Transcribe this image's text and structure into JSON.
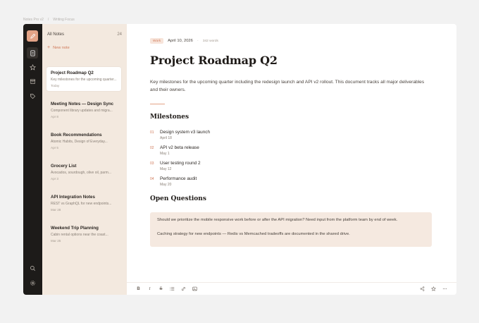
{
  "breadcrumb": [
    "Notes Pro v2",
    "Writing Focus"
  ],
  "rail": {
    "icons": [
      "pen-icon",
      "document-icon",
      "star-icon",
      "archive-icon",
      "tag-icon",
      "search-icon",
      "settings-icon"
    ]
  },
  "sidebar": {
    "title": "All Notes",
    "count": "24",
    "new_note": "New note",
    "notes": [
      {
        "title": "Project Roadmap Q2",
        "preview": "Key milestones for the upcoming quarter...",
        "date": "Today"
      },
      {
        "title": "Meeting Notes — Design Sync",
        "preview": "Component library updates and migra...",
        "date": "Apr 8"
      },
      {
        "title": "Book Recommendations",
        "preview": "Atomic Habits, Design of Everyday...",
        "date": "Apr 5"
      },
      {
        "title": "Grocery List",
        "preview": "Avocados, sourdough, olive oil, parm...",
        "date": "Apr 3"
      },
      {
        "title": "API Integration Notes",
        "preview": "REST vs GraphQL for new endpoints...",
        "date": "Mar 28"
      },
      {
        "title": "Weekend Trip Planning",
        "preview": "Cabin rental options near the coast...",
        "date": "Mar 25"
      }
    ]
  },
  "editor": {
    "tag": "Work",
    "date": "April 10, 2026",
    "words": "342 words",
    "title": "Project Roadmap Q2",
    "intro": "Key milestones for the upcoming quarter including the redesign launch and API v2 rollout. This document tracks all major deliverables and their owners.",
    "milestones_heading": "Milestones",
    "milestones": [
      {
        "num": "01",
        "title": "Design system v3 launch",
        "date": "April 18"
      },
      {
        "num": "02",
        "title": "API v2 beta release",
        "date": "May 1"
      },
      {
        "num": "03",
        "title": "User testing round 2",
        "date": "May 12"
      },
      {
        "num": "04",
        "title": "Performance audit",
        "date": "May 20"
      }
    ],
    "questions_heading": "Open Questions",
    "questions": [
      "Should we prioritize the mobile responsive work before or after the API migration? Need input from the platform team by end of week.",
      "Caching strategy for new endpoints — Redis vs Memcached tradeoffs are documented in the shared drive."
    ]
  },
  "toolbar": {
    "bold": "B",
    "italic": "I",
    "strike": "S"
  }
}
